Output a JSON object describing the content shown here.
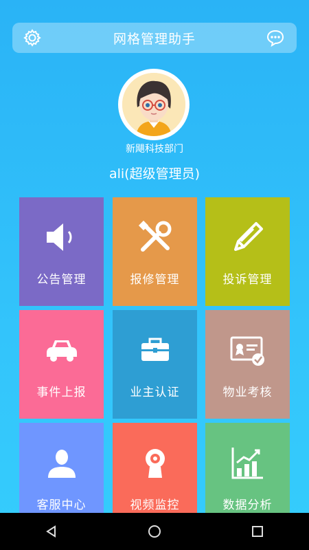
{
  "header": {
    "title": "网格管理助手",
    "left_icon": "gear-icon",
    "right_icon": "chat-bubble-icon"
  },
  "profile": {
    "avatar": "cartoon-user-avatar",
    "department": "新飓科技部门",
    "user": "ali(超级管理员)"
  },
  "tiles": [
    {
      "label": "公告管理",
      "icon": "speaker-icon",
      "color": "#7b6ac6"
    },
    {
      "label": "报修管理",
      "icon": "tools-icon",
      "color": "#e5994a"
    },
    {
      "label": "投诉管理",
      "icon": "pencil-icon",
      "color": "#b5bf18"
    },
    {
      "label": "事件上报",
      "icon": "car-icon",
      "color": "#fb6b96"
    },
    {
      "label": "业主认证",
      "icon": "toolbox-icon",
      "color": "#2e9ed3"
    },
    {
      "label": "物业考核",
      "icon": "certificate-icon",
      "color": "#c0978b"
    },
    {
      "label": "客服中心",
      "icon": "person-icon",
      "color": "#6f96ff"
    },
    {
      "label": "视频监控",
      "icon": "webcam-icon",
      "color": "#fa6b5a"
    },
    {
      "label": "数据分析",
      "icon": "bar-chart-icon",
      "color": "#67c381"
    }
  ],
  "navbar": [
    "back-icon",
    "home-icon",
    "recents-icon"
  ]
}
